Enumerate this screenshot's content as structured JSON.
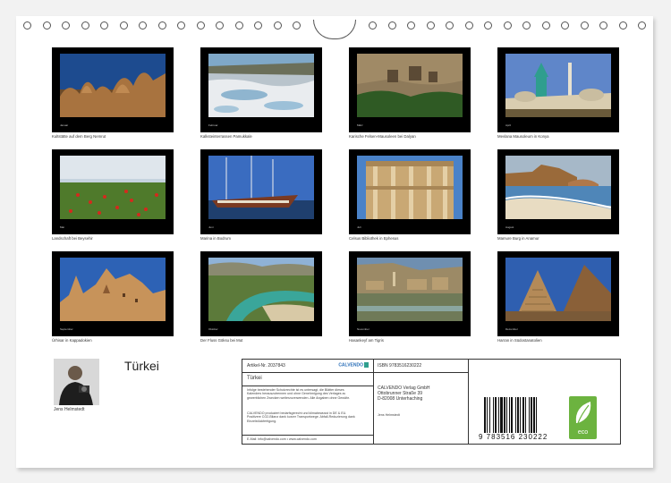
{
  "title": "Türkei",
  "author": "Jens Helmstedt",
  "months": [
    {
      "caption": "Kultstätte auf dem Berg Nemrut",
      "month": "Januar"
    },
    {
      "caption": "Kalksteinterrassen Pamukkale",
      "month": "Februar"
    },
    {
      "caption": "Karische Felsen-Mausoleen bei Dalyan",
      "month": "März"
    },
    {
      "caption": "Mevlana Mausoleum in Konya",
      "month": "April"
    },
    {
      "caption": "Landschaft bei Beysehir",
      "month": "Mai"
    },
    {
      "caption": "Marina in Bodrum",
      "month": "Juni"
    },
    {
      "caption": "Celsus Bibliothek in Ephesus",
      "month": "Juli"
    },
    {
      "caption": "Mamure Burg in Anamur",
      "month": "August"
    },
    {
      "caption": "Ürhisar in Kappadokien",
      "month": "September"
    },
    {
      "caption": "Der Fluss Göksu bei Mut",
      "month": "Oktober"
    },
    {
      "caption": "Hasankeyf am Tigris",
      "month": "November"
    },
    {
      "caption": "Harran in Südostanatolien",
      "month": "Dezember"
    }
  ],
  "info": {
    "article_no": "Artikel-Nr. 2037843",
    "brand": "CALVENDO",
    "product_title": "Türkei",
    "rights_text": "Infolge bestehender Schutzrechte ist es untersagt, die Blätter dieses Kalenders herauszutrennen und ohne Genehmigung des Verlages zu gewerblichen Zwecken weiterzuverwenden. Alle Angaben ohne Gewähr.",
    "climate_text": "CALVENDO produziert bedarfsgerecht und klimabewusst in DE & EU. Positivere CO2-Bilanz dank kurzer Transportwege. Abfall-Reduzierung dank Einzelstückfertigung.",
    "contact": "E-Mail: info@calvendo.com • www.calvendo.com",
    "isbn": "ISBN 9783516230222",
    "publisher_name": "CALVENDO Verlag GmbH",
    "publisher_street": "Ottobrunner Straße 39",
    "publisher_city": "D-82008 Unterhaching",
    "author": "Jens Helmstedt",
    "barcode_number": "9 783516 230222",
    "eco_label": "eco"
  },
  "icons": [
    "calendar-ring-icon",
    "eco-leaf-icon",
    "barcode-icon"
  ]
}
